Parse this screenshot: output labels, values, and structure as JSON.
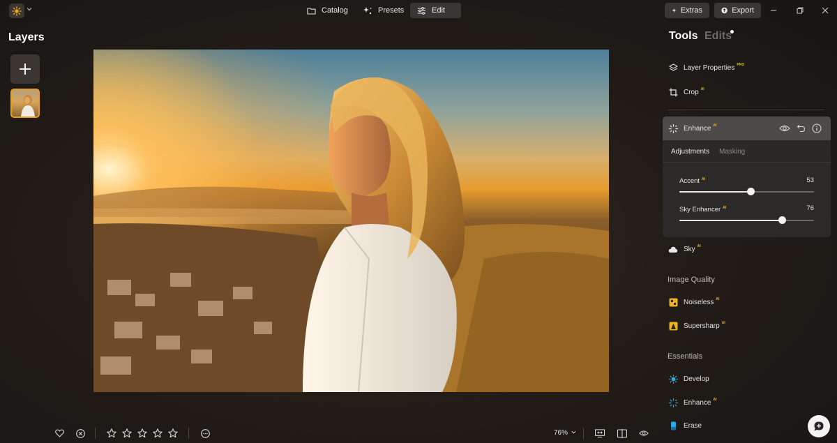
{
  "topbar": {
    "tabs": [
      {
        "label": "Catalog",
        "icon": "folder-icon"
      },
      {
        "label": "Presets",
        "icon": "sparkle-icon"
      },
      {
        "label": "Edit",
        "icon": "sliders-icon",
        "active": true
      }
    ],
    "extras_label": "Extras",
    "export_label": "Export"
  },
  "layers": {
    "title": "Layers",
    "add_icon": "plus-icon"
  },
  "right_panel": {
    "tools_tab": "Tools",
    "edits_tab": "Edits",
    "items": [
      {
        "label": "Layer Properties",
        "badge": "PRO",
        "icon": "layers-icon"
      },
      {
        "label": "Crop",
        "badge": "AI",
        "icon": "crop-icon"
      }
    ],
    "enhance": {
      "label": "Enhance",
      "badge": "AI",
      "tabs": [
        "Adjustments",
        "Masking"
      ],
      "sliders": [
        {
          "label": "Accent",
          "badge": "AI",
          "value": "53",
          "level": 0.53
        },
        {
          "label": "Sky Enhancer",
          "badge": "AI",
          "value": "76",
          "level": 0.76
        }
      ]
    },
    "sky": {
      "label": "Sky",
      "badge": "AI"
    },
    "image_quality": {
      "title": "Image Quality",
      "items": [
        {
          "label": "Noiseless",
          "badge": "AI"
        },
        {
          "label": "Supersharp",
          "badge": "AI"
        }
      ]
    },
    "essentials": {
      "title": "Essentials",
      "items": [
        {
          "label": "Develop",
          "badge": ""
        },
        {
          "label": "Enhance",
          "badge": "AI"
        },
        {
          "label": "Erase",
          "badge": ""
        }
      ]
    }
  },
  "bottombar": {
    "zoom": "76%",
    "rating_stars": 5,
    "rating_value": 0
  },
  "colors": {
    "accent": "#e8a116",
    "panel_active": "#4d4a47",
    "badge": "#e8b53a"
  }
}
